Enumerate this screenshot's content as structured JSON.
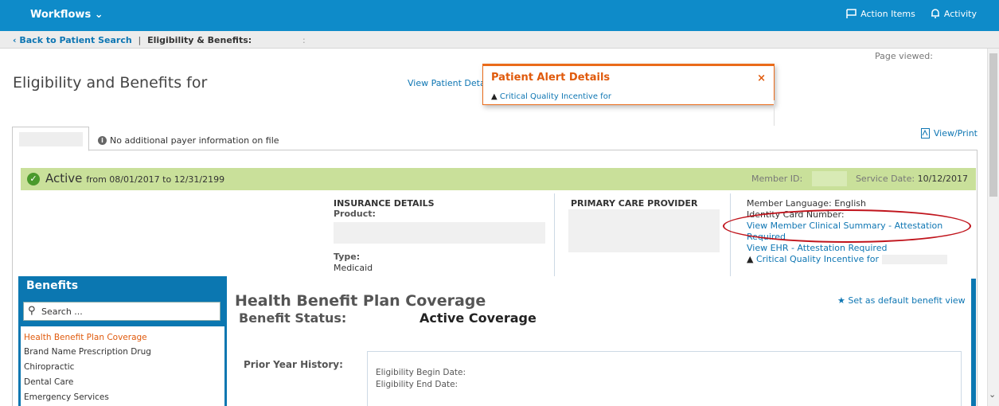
{
  "topbar": {
    "workflows_label": "Workflows",
    "action_items_label": "Action Items",
    "activity_label": "Activity"
  },
  "breadcrumb": {
    "back_label": "Back to Patient Search",
    "separator": "|",
    "current": "Eligibility & Benefits:",
    "colon": ":"
  },
  "header": {
    "page_viewed": "Page viewed:",
    "title": "Eligibility and Benefits for",
    "view_patient_details": "View Patient Details"
  },
  "alert": {
    "title": "Patient Alert Details",
    "close": "×",
    "line": "Critical Quality Incentive for"
  },
  "tabs": {
    "no_payer": "No additional payer information on file",
    "view_print": "View/Print"
  },
  "status": {
    "active": "Active",
    "range": "from 08/01/2017 to 12/31/2199",
    "member_id_label": "Member ID:",
    "service_date_label": "Service Date:",
    "service_date": "10/12/2017"
  },
  "insurance": {
    "heading": "INSURANCE DETAILS",
    "product_label": "Product:",
    "type_label": "Type:",
    "type_value": "Medicaid"
  },
  "pcp": {
    "heading": "PRIMARY CARE PROVIDER"
  },
  "member": {
    "language": "Member Language: English",
    "identity": "Identity Card Number:",
    "clinical_summary": "View Member Clinical Summary - Attestation Required",
    "view_ehr": "View EHR - Attestation Required",
    "critical": "Critical Quality Incentive for"
  },
  "benefits": {
    "title": "Benefits",
    "search_placeholder": "Search ...",
    "items": [
      "Health Benefit Plan Coverage",
      "Brand Name Prescription Drug",
      "Chiropractic",
      "Dental Care",
      "Emergency Services"
    ]
  },
  "coverage": {
    "title": "Health Benefit Plan Coverage",
    "set_default": "Set as default benefit view",
    "status_label": "Benefit Status:",
    "status_value": "Active Coverage",
    "prior_year": "Prior Year History:",
    "begin_date": "Eligibility Begin Date:",
    "end_date": "Eligibility End Date:"
  },
  "colors": {
    "topbar": "#0e8bc9",
    "accent_orange": "#e05a0c",
    "status_green": "#c9e09a",
    "link_blue": "#0e76b3",
    "benefits_blue": "#0b77b1",
    "annotation_red": "#c0141c"
  }
}
